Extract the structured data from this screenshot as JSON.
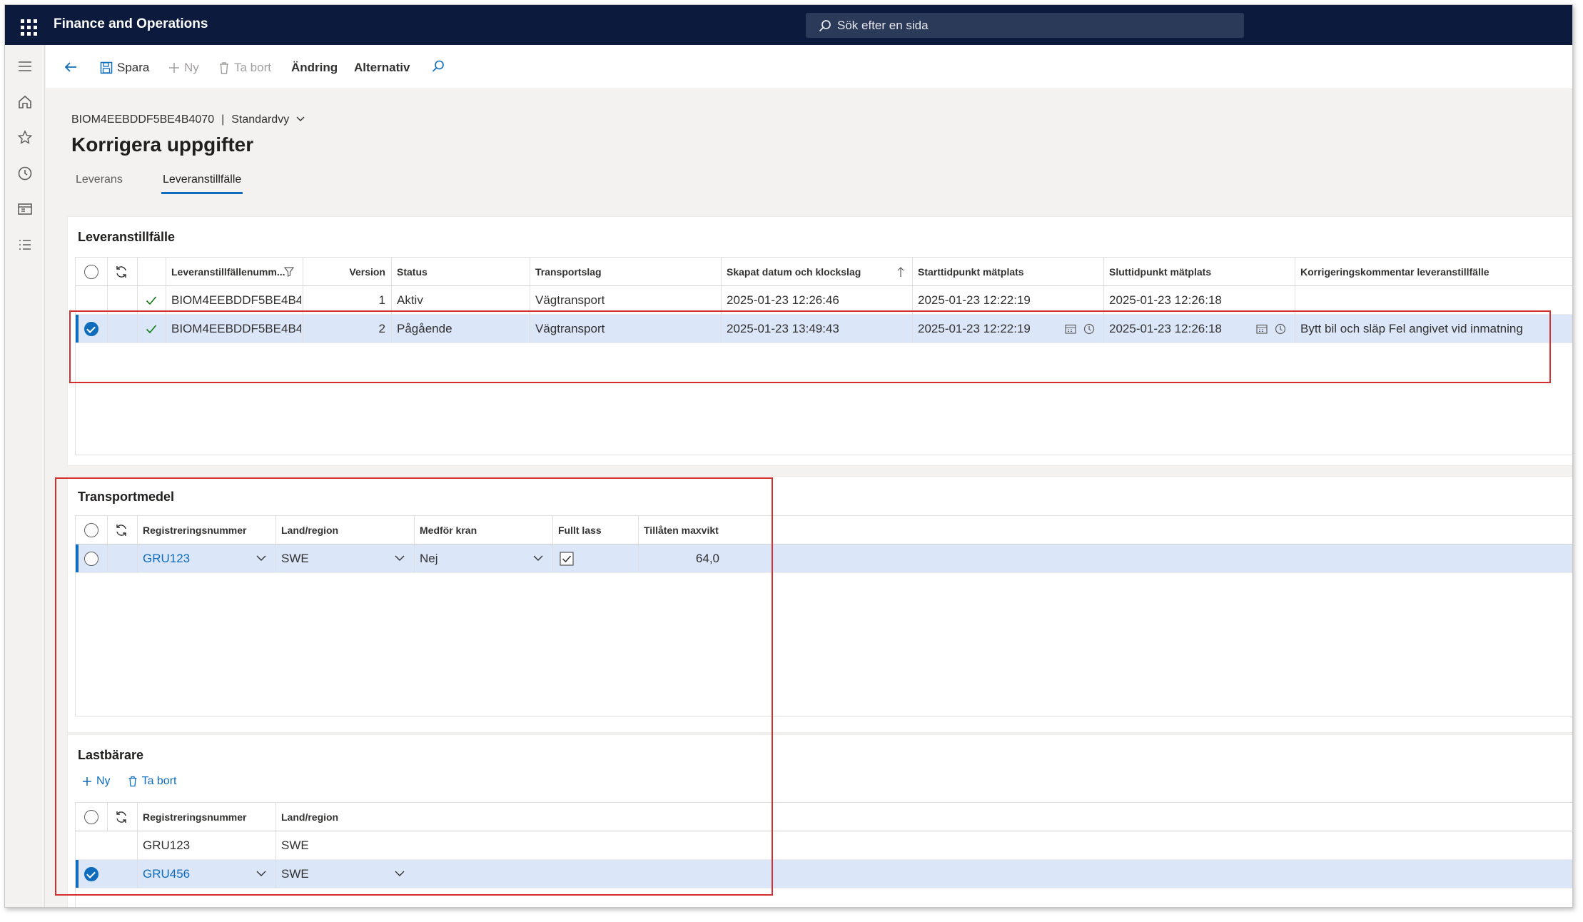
{
  "app": {
    "title": "Finance and Operations",
    "search_placeholder": "Sök efter en sida"
  },
  "toolbar": {
    "save": "Spara",
    "new": "Ny",
    "delete": "Ta bort",
    "change": "Ändring",
    "options": "Alternativ"
  },
  "breadcrumb": {
    "record_id": "BIOM4EEBDDF5BE4B4070",
    "separator": "|",
    "view": "Standardvy"
  },
  "page": {
    "title": "Korrigera uppgifter"
  },
  "tabs": [
    {
      "label": "Leverans"
    },
    {
      "label": "Leveranstillfälle"
    }
  ],
  "delivery_section": {
    "title": "Leveranstillfälle",
    "columns": {
      "number": "Leveranstillfällenumm...",
      "version": "Version",
      "status": "Status",
      "transport": "Transportslag",
      "created": "Skapat datum och klockslag",
      "start": "Starttidpunkt mätplats",
      "end": "Sluttidpunkt mätplats",
      "comment": "Korrigeringskommentar leveranstillfälle"
    },
    "rows": [
      {
        "number": "BIOM4EEBDDF5BE4B4...",
        "version": "1",
        "status": "Aktiv",
        "transport": "Vägtransport",
        "created": "2025-01-23 12:26:46",
        "start": "2025-01-23 12:22:19",
        "end": "2025-01-23 12:26:18",
        "comment": ""
      },
      {
        "number": "BIOM4EEBDDF5BE4B4...",
        "version": "2",
        "status": "Pågående",
        "transport": "Vägtransport",
        "created": "2025-01-23 13:49:43",
        "start": "2025-01-23 12:22:19",
        "end": "2025-01-23 12:26:18",
        "comment": "Bytt bil och släp Fel angivet vid inmatning"
      }
    ]
  },
  "transport_section": {
    "title": "Transportmedel",
    "columns": {
      "reg": "Registreringsnummer",
      "country": "Land/region",
      "crane": "Medför kran",
      "full": "Fullt lass",
      "maxweight": "Tillåten maxvikt"
    },
    "rows": [
      {
        "reg": "GRU123",
        "country": "SWE",
        "crane": "Nej",
        "full": true,
        "maxweight": "64,0"
      }
    ]
  },
  "carrier_section": {
    "title": "Lastbärare",
    "new": "Ny",
    "delete": "Ta bort",
    "columns": {
      "reg": "Registreringsnummer",
      "country": "Land/region"
    },
    "rows": [
      {
        "reg": "GRU123",
        "country": "SWE"
      },
      {
        "reg": "GRU456",
        "country": "SWE"
      }
    ]
  },
  "colors": {
    "topbar": "#0c1b3d",
    "accent": "#0f6cbd",
    "selected_row": "#dbe6f8",
    "highlight_box": "#d32f2f"
  }
}
